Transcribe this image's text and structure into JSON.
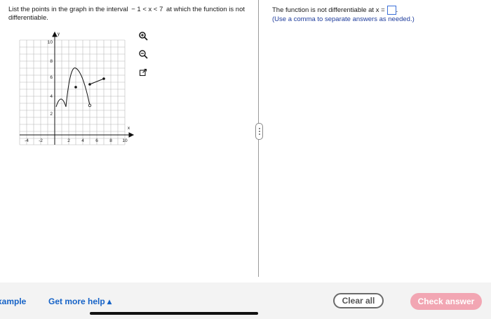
{
  "question": {
    "prompt_part1": "List the points in the graph in the interval",
    "interval": "− 1 < x < 7",
    "prompt_part2": "at which the function is not differentiable."
  },
  "answer_panel": {
    "statement": "The function is not differentiable at x =",
    "answer_value": "",
    "hint": "(Use a comma to separate answers as needed.)"
  },
  "graph": {
    "x_ticks": [
      "-4",
      "-2",
      "2",
      "4",
      "6",
      "8",
      "10"
    ],
    "y_ticks": [
      "10",
      "8",
      "6",
      "4",
      "2"
    ],
    "x_axis_label": "x",
    "y_axis_label": "y",
    "grid": true
  },
  "tools": {
    "zoom_in_icon": "zoom-in-icon",
    "zoom_out_icon": "zoom-out-icon",
    "popout_icon": "external-link-icon"
  },
  "footer": {
    "example_label": "xample",
    "help_label": "Get more help ▴",
    "clear_label": "Clear all",
    "check_label": "Check answer"
  },
  "colors": {
    "link_blue": "#1663c7",
    "hint_blue": "#1e3c9c",
    "check_button": "#f2a6b3"
  }
}
